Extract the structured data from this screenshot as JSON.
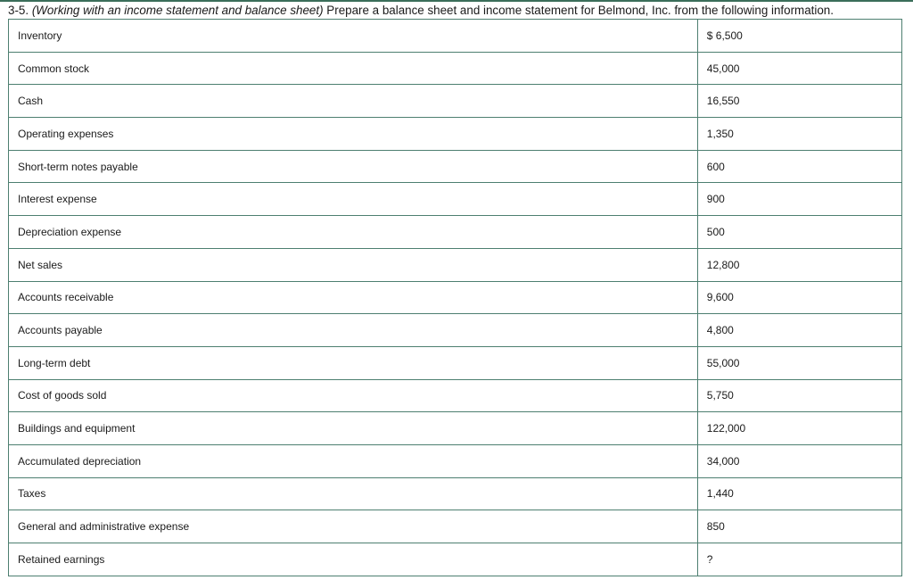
{
  "problem": {
    "number": "3-5.",
    "title": "(Working with an income statement and balance sheet)",
    "text": "Prepare a balance sheet and income statement for Belmond, Inc. from the following information."
  },
  "table": {
    "rows": [
      {
        "label": "Inventory",
        "value": "$ 6,500"
      },
      {
        "label": "Common stock",
        "value": "45,000"
      },
      {
        "label": "Cash",
        "value": "16,550"
      },
      {
        "label": "Operating expenses",
        "value": "1,350"
      },
      {
        "label": "Short-term notes payable",
        "value": "600"
      },
      {
        "label": "Interest expense",
        "value": "900"
      },
      {
        "label": "Depreciation expense",
        "value": "500"
      },
      {
        "label": "Net sales",
        "value": "12,800"
      },
      {
        "label": "Accounts receivable",
        "value": "9,600"
      },
      {
        "label": "Accounts payable",
        "value": "4,800"
      },
      {
        "label": "Long-term debt",
        "value": "55,000"
      },
      {
        "label": "Cost of goods sold",
        "value": "5,750"
      },
      {
        "label": "Buildings and equipment",
        "value": "122,000"
      },
      {
        "label": "Accumulated depreciation",
        "value": "34,000"
      },
      {
        "label": "Taxes",
        "value": "1,440"
      },
      {
        "label": "General and administrative expense",
        "value": "850"
      },
      {
        "label": "Retained earnings",
        "value": "?"
      }
    ]
  }
}
